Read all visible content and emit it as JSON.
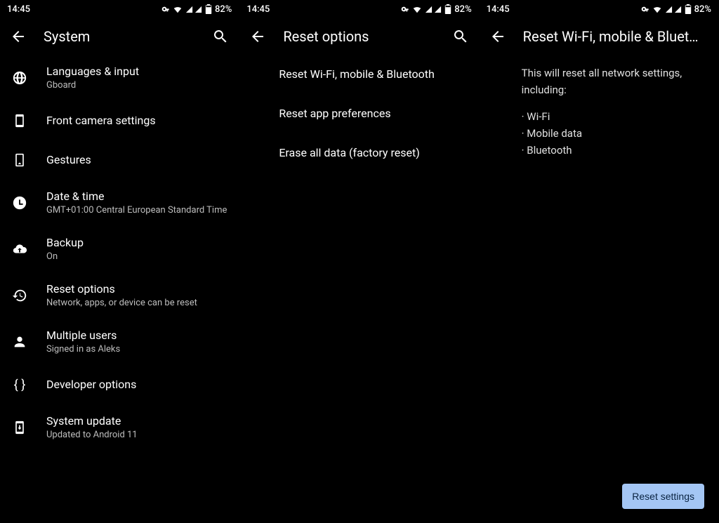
{
  "status": {
    "time": "14:45",
    "battery": "82%"
  },
  "screen1": {
    "title": "System",
    "items": [
      {
        "title": "Languages & input",
        "sub": "Gboard"
      },
      {
        "title": "Front camera settings",
        "sub": ""
      },
      {
        "title": "Gestures",
        "sub": ""
      },
      {
        "title": "Date & time",
        "sub": "GMT+01:00 Central European Standard Time"
      },
      {
        "title": "Backup",
        "sub": "On"
      },
      {
        "title": "Reset options",
        "sub": "Network, apps, or device can be reset"
      },
      {
        "title": "Multiple users",
        "sub": "Signed in as Aleks"
      },
      {
        "title": "Developer options",
        "sub": ""
      },
      {
        "title": "System update",
        "sub": "Updated to Android 11"
      }
    ]
  },
  "screen2": {
    "title": "Reset options",
    "items": [
      {
        "title": "Reset Wi-Fi, mobile & Bluetooth"
      },
      {
        "title": "Reset app preferences"
      },
      {
        "title": "Erase all data (factory reset)"
      }
    ]
  },
  "screen3": {
    "title": "Reset Wi-Fi, mobile & Blueto…",
    "intro": "This will reset all network settings, including:",
    "bullets": [
      "Wi-Fi",
      "Mobile data",
      "Bluetooth"
    ],
    "button": "Reset settings"
  }
}
